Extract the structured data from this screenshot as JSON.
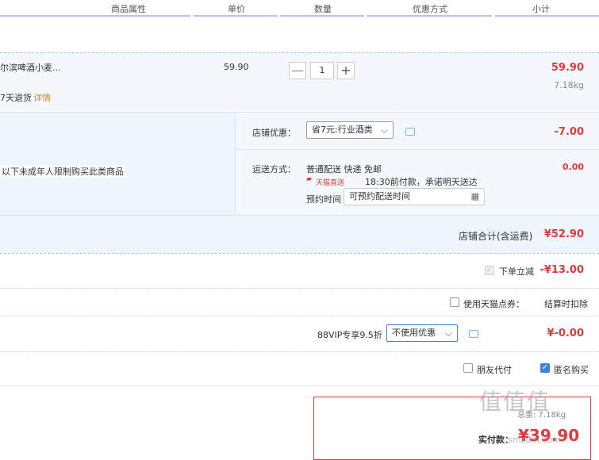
{
  "header": {
    "columns": [
      "商品属性",
      "单价",
      "数量",
      "优惠方式",
      "小计"
    ]
  },
  "item": {
    "name": "尔滨啤酒小麦...",
    "price": "59.90",
    "qty_minus": "—",
    "qty": "1",
    "qty_plus": "+",
    "subtotal": "59.90",
    "weight": "7.18kg",
    "return_text": "7天退货",
    "return_link": "详情"
  },
  "shop": {
    "discount_label": "店铺优惠：",
    "discount_select": "省7元:行业酒类",
    "discount_value": "-7.00",
    "notice": "以下未成年人限制购买此类商品",
    "shipping_label": "运送方式：",
    "shipping_method": "普通配送 快递 免邮",
    "tmall_badge": "天猫直送",
    "delivery_promise": "18:30前付款，承诺明天送达",
    "appt_label": "预约时间",
    "appt_placeholder": "可预约配送时间",
    "shipping_value": "0.00",
    "total_label": "店铺合计(含运费)",
    "total_value": "¥52.90"
  },
  "order": {
    "instant_label": "下单立减",
    "instant_value": "-¥13.00",
    "points_label": "使用天猫点券：",
    "points_value": "结算时扣除",
    "vip_label": "88VIP专享9.5折",
    "vip_select": "不使用优惠",
    "vip_value": "¥-0.00",
    "friend_pay": "朋友代付",
    "anonymous": "匿名购买"
  },
  "summary": {
    "weight_text": "总重: 7.18kg",
    "pay_label": "实付款：",
    "pay_value": "¥39.90"
  },
  "watermark": "值 什么值得买 smzdm.com",
  "colors": {
    "accent_red": "#e4393c",
    "link_orange": "#ff6a00",
    "blue_check": "#3a82e0",
    "band_blue": "#eef4fc"
  }
}
